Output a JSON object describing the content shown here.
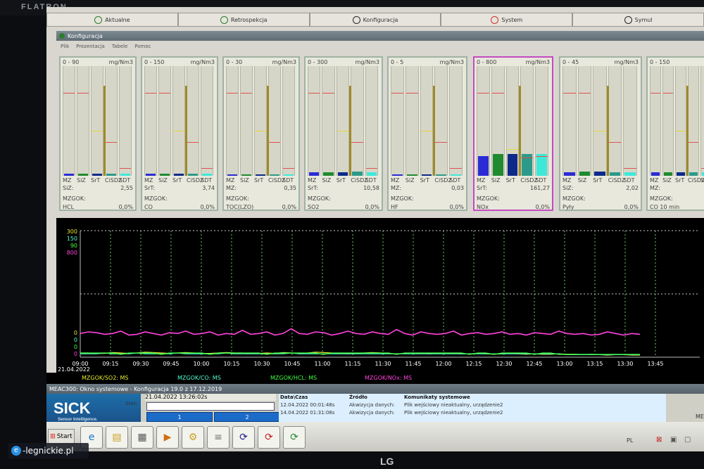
{
  "bezel": {
    "brand": "FLATRON",
    "logo": "LG"
  },
  "watermark": {
    "letter": "e",
    "text": "-legnickie.pl"
  },
  "tabs": [
    {
      "label": "Aktualne",
      "icon": "arrow-icon",
      "color": "#2c7c2c"
    },
    {
      "label": "Retrospekcja",
      "icon": "arrow-icon",
      "color": "#2c7c2c"
    },
    {
      "label": "Konfiguracja",
      "icon": "arrow-icon",
      "color": "#222222"
    },
    {
      "label": "System",
      "icon": "arrow-icon",
      "color": "#d03030"
    },
    {
      "label": "Symul",
      "icon": "arrow-icon",
      "color": "#222222"
    }
  ],
  "window": {
    "title": "Konfiguracja",
    "menu": [
      "Plik",
      "Prezentacja",
      "Tabele",
      "Pomoc"
    ]
  },
  "panels": [
    {
      "range": "0 - 90",
      "unit": "mg/Nm3",
      "stat_label": "SiZ:",
      "value": "2,55",
      "site": "MZGOK:",
      "component": "HCL",
      "pct": "0,0%"
    },
    {
      "range": "0 - 150",
      "unit": "mg/Nm3",
      "stat_label": "SrT:",
      "value": "3,74",
      "site": "MZGOK:",
      "component": "CO",
      "pct": "0,0%"
    },
    {
      "range": "0 - 30",
      "unit": "mg/Nm3",
      "stat_label": "MZ:",
      "value": "0,35",
      "site": "MZGOK:",
      "component": "TOC(LZO)",
      "pct": "0,0%"
    },
    {
      "range": "0 - 300",
      "unit": "mg/Nm3",
      "stat_label": "SrT:",
      "value": "10,58",
      "site": "MZGOK:",
      "component": "SO2",
      "pct": "0,0%"
    },
    {
      "range": "0 - 5",
      "unit": "mg/Nm3",
      "stat_label": "MZ:",
      "value": "0,03",
      "site": "MZGOK:",
      "component": "HF",
      "pct": "0,0%"
    },
    {
      "range": "0 - 800",
      "unit": "mg/Nm3",
      "stat_label": "SrT:",
      "value": "161,27",
      "site": "MZGOK:",
      "component": "NOx",
      "pct": "0,0%"
    },
    {
      "range": "0 - 45",
      "unit": "mg/Nm3",
      "stat_label": "SiZ:",
      "value": "2,02",
      "site": "MZGOK:",
      "component": "Pyły",
      "pct": "0,0%"
    },
    {
      "range": "0 - 150",
      "unit": "",
      "stat_label": "MZ:",
      "value": "",
      "site": "MZGOK:",
      "component": "CO 10 min",
      "pct": ""
    }
  ],
  "bar_labels": [
    "MZ",
    "SiZ",
    "SrT",
    "CiSDZ",
    "SDT"
  ],
  "bar_colors": [
    "#2b2bd6",
    "#208a30",
    "#0d2a8a",
    "#2c9a8a",
    "#3ee8d8"
  ],
  "chart_data": {
    "type": "line",
    "left_ticks": [
      {
        "text": "300",
        "color": "#e8e830"
      },
      {
        "text": "150",
        "color": "#50ffd0"
      },
      {
        "text": "90",
        "color": "#40ff40"
      },
      {
        "text": "800",
        "color": "#ff44dd"
      }
    ],
    "bottom_ticks": [
      {
        "text": "0",
        "color": "#e8e830"
      },
      {
        "text": "0",
        "color": "#50ffd0"
      },
      {
        "text": "0",
        "color": "#40ff40"
      },
      {
        "text": "0",
        "color": "#ff44dd"
      }
    ],
    "date": "21.04.2022",
    "x_labels": [
      "09:00",
      "09:15",
      "09:30",
      "09:45",
      "10:00",
      "10:15",
      "10:30",
      "10:45",
      "11:00",
      "11:15",
      "11:30",
      "11:45",
      "12:00",
      "12:15",
      "12:30",
      "12:45",
      "13:00",
      "13:15",
      "13:30",
      "13:45"
    ],
    "series": [
      {
        "name": "MZGOK/SO2: MS",
        "color": "#e8e830",
        "values": [
          10,
          10,
          9,
          9,
          11,
          10,
          9,
          10,
          12,
          11,
          10,
          9,
          10,
          11,
          10,
          9,
          9,
          10,
          11,
          10,
          10,
          9,
          9,
          10,
          9,
          11,
          10,
          9,
          10,
          12,
          11,
          10,
          9,
          8,
          9,
          10,
          11,
          10,
          9,
          8,
          9,
          10,
          9,
          8,
          9,
          10,
          9,
          8,
          8,
          9,
          8,
          7,
          8,
          9,
          8,
          7,
          8,
          7,
          7,
          8,
          7,
          7,
          6,
          7,
          6,
          5,
          6,
          6,
          5,
          5
        ]
      },
      {
        "name": "MZGOK/CO: MS",
        "color": "#50ffd0",
        "values": [
          4,
          4,
          4,
          5,
          4,
          4,
          4,
          5,
          4,
          4,
          4,
          4,
          5,
          4,
          4,
          4,
          4,
          4,
          5,
          4,
          4,
          4,
          4,
          4,
          4,
          4,
          5,
          4,
          4,
          4,
          4,
          4,
          4,
          4,
          4,
          4,
          4,
          4,
          4,
          4,
          4,
          4,
          4,
          4,
          4,
          4,
          4,
          4,
          4,
          4,
          4,
          4,
          4,
          4,
          4,
          4,
          4,
          4,
          4,
          4,
          3,
          3,
          3,
          3,
          3,
          3,
          3,
          3,
          3,
          3
        ]
      },
      {
        "name": "MZGOK/HCL: MS",
        "color": "#40ff40",
        "values": [
          3,
          3,
          3,
          3,
          3,
          2,
          3,
          3,
          3,
          3,
          2,
          3,
          3,
          3,
          3,
          3,
          2,
          3,
          3,
          3,
          3,
          3,
          3,
          2,
          3,
          3,
          3,
          3,
          3,
          3,
          2,
          3,
          3,
          3,
          3,
          3,
          3,
          3,
          3,
          2,
          3,
          3,
          3,
          3,
          3,
          3,
          3,
          3,
          2,
          3,
          3,
          2,
          3,
          3,
          3,
          3,
          2,
          3,
          3,
          2,
          2,
          2,
          2,
          2,
          2,
          2,
          2,
          2,
          2,
          2
        ]
      },
      {
        "name": "MZGOK/NOx: MS",
        "color": "#ff44dd",
        "values": [
          150,
          160,
          155,
          145,
          150,
          165,
          140,
          145,
          160,
          150,
          140,
          155,
          150,
          165,
          145,
          150,
          160,
          140,
          150,
          145,
          170,
          145,
          150,
          160,
          140,
          150,
          180,
          150,
          145,
          160,
          155,
          140,
          150,
          165,
          150,
          145,
          160,
          150,
          145,
          175,
          150,
          140,
          160,
          150,
          145,
          150,
          165,
          140,
          150,
          155,
          145,
          150,
          160,
          145,
          150,
          140,
          155,
          150,
          145,
          165,
          150,
          145,
          150,
          140,
          145,
          160,
          150,
          140,
          150,
          145
        ]
      }
    ]
  },
  "legend": [
    {
      "text": "MZGOK/SO2: MS",
      "color": "#e8e830"
    },
    {
      "text": "MZGOK/CO: MS",
      "color": "#50ffd0"
    },
    {
      "text": "MZGOK/HCL: MS",
      "color": "#40ff40"
    },
    {
      "text": "MZGOK/NOx: MS",
      "color": "#ff44dd"
    }
  ],
  "system_window": {
    "title": "MEAC300: Okno systemowe - Konfiguracja 19.0 z 17.12.2019",
    "logo": "SICK",
    "logo_sub": "Sensor Intelligence.",
    "state_label": "Stan:",
    "datetime": "21.04.2022 13:26:02s",
    "buttons": [
      "1",
      "2"
    ],
    "log_headers": [
      "Data\\Czas",
      "Źródło",
      "Komunikaty systemowe"
    ],
    "log_rows": [
      [
        "12.04.2022 00:01:48s",
        "Akwizycja danych:",
        "Plik wejściowy nieaktualny, urządzenie2"
      ],
      [
        "14.04.2022 01:31:08s",
        "Akwizycja danych:",
        "Plik wejściowy nieaktualny, urządzenie2"
      ]
    ],
    "right_text": "ME"
  },
  "taskbar": {
    "start": "Start",
    "lang": "PL"
  }
}
